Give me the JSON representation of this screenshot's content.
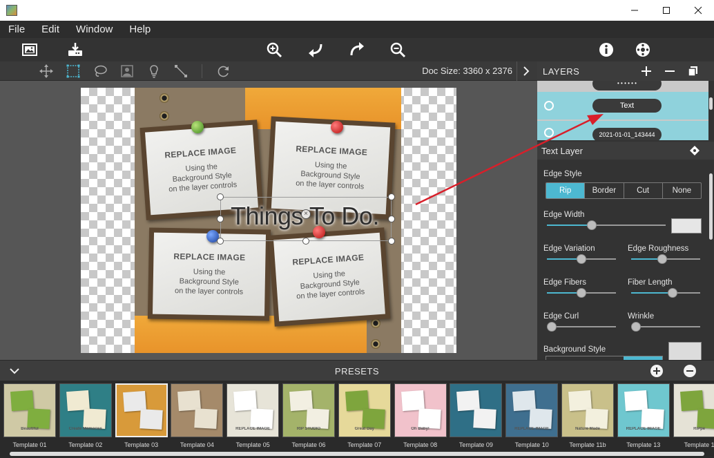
{
  "titlebar": {
    "controls": [
      "minimize",
      "maximize",
      "close"
    ]
  },
  "menu": {
    "items": [
      "File",
      "Edit",
      "Window",
      "Help"
    ]
  },
  "toolbar": {
    "left_icons": [
      "open-image-icon",
      "save-tray-icon"
    ],
    "center_icons": [
      "zoom-in-icon",
      "undo-icon",
      "redo-icon",
      "zoom-out-icon"
    ],
    "right_icons": [
      "info-icon",
      "settings-icon"
    ]
  },
  "subtoolbar": {
    "tools": [
      "move-tool-icon",
      "rect-select-icon",
      "lasso-icon",
      "portrait-frame-icon",
      "lightbulb-icon",
      "line-tool-icon",
      "refresh-icon"
    ],
    "doc_size": "Doc Size: 3360 x 2376"
  },
  "canvas": {
    "placeholders": [
      {
        "title": "REPLACE IMAGE",
        "sub": [
          "Using the",
          "Background Style",
          "on the layer controls"
        ]
      },
      {
        "title": "REPLACE IMAGE",
        "sub": [
          "Using the",
          "Background Style",
          "on the layer controls"
        ]
      },
      {
        "title": "REPLACE IMAGE",
        "sub": [
          "Using the",
          "Background Style",
          "on the layer controls"
        ]
      },
      {
        "title": "REPLACE IMAGE",
        "sub": [
          "Using the",
          "Background Style",
          "on the layer controls"
        ]
      }
    ],
    "text_layer": "Things To Do."
  },
  "layers": {
    "title": "LAYERS",
    "rows": [
      {
        "label": "• • • • • •",
        "selected": false
      },
      {
        "label": "Text",
        "selected": true
      },
      {
        "label": "2021-01-01_143444",
        "selected": false
      }
    ]
  },
  "text_layer_panel": {
    "title": "Text Layer",
    "edge_style": {
      "label": "Edge Style",
      "options": [
        "Rip",
        "Border",
        "Cut",
        "None"
      ],
      "active": "Rip"
    },
    "sliders": [
      {
        "label": "Edge Width",
        "value": 0.38
      },
      {
        "label": "Edge Variation",
        "value": 0.5
      },
      {
        "label": "Edge Roughness",
        "value": 0.45
      },
      {
        "label": "Edge Fibers",
        "value": 0.5
      },
      {
        "label": "Fiber Length",
        "value": 0.6
      },
      {
        "label": "Edge Curl",
        "value": 0.0
      },
      {
        "label": "Wrinkle",
        "value": 0.0
      }
    ],
    "background_style_label": "Background Style"
  },
  "presets": {
    "title": "PRESETS",
    "templates": [
      {
        "label": "Template 01",
        "bg": "#cfc9a5",
        "accent": "#7fae3f",
        "caption": "Beautiful"
      },
      {
        "label": "Template 02",
        "bg": "#2f7f86",
        "accent": "#f0ead2",
        "caption": "Create Memories"
      },
      {
        "label": "Template 03",
        "bg": "#d89a3a",
        "accent": "#eaeaea",
        "caption": ""
      },
      {
        "label": "Template 04",
        "bg": "#a58a6a",
        "accent": "#e8e1d0",
        "caption": ""
      },
      {
        "label": "Template 05",
        "bg": "#e7e4d8",
        "accent": "#ffffff",
        "caption": "REPLACE IMAGE"
      },
      {
        "label": "Template 06",
        "bg": "#a4b36a",
        "accent": "#f2efe2",
        "caption": "RIP STUDIO"
      },
      {
        "label": "Template 07",
        "bg": "#e6d99a",
        "accent": "#7ea53d",
        "caption": "Great Day"
      },
      {
        "label": "Template 08",
        "bg": "#f1c2cb",
        "accent": "#ffffff",
        "caption": "Oh Baby!"
      },
      {
        "label": "Template 09",
        "bg": "#2f6f86",
        "accent": "#f2f2f2",
        "caption": ""
      },
      {
        "label": "Template 10",
        "bg": "#3f6f8f",
        "accent": "#dfe7ec",
        "caption": "REPLACE IMAGE"
      },
      {
        "label": "Template 11b",
        "bg": "#c9c08a",
        "accent": "#f3f0de",
        "caption": "Nature Made"
      },
      {
        "label": "Template 13",
        "bg": "#6fc7cf",
        "accent": "#ffffff",
        "caption": "REPLACE IMAGE"
      },
      {
        "label": "Template 1",
        "bg": "#e5e2d6",
        "accent": "#7ea53d",
        "caption": "RiPpe"
      }
    ]
  },
  "colors": {
    "accent": "#4db8d1",
    "annotation_arrow": "#d81f2a",
    "layer_selected": "#8fd2dc"
  }
}
